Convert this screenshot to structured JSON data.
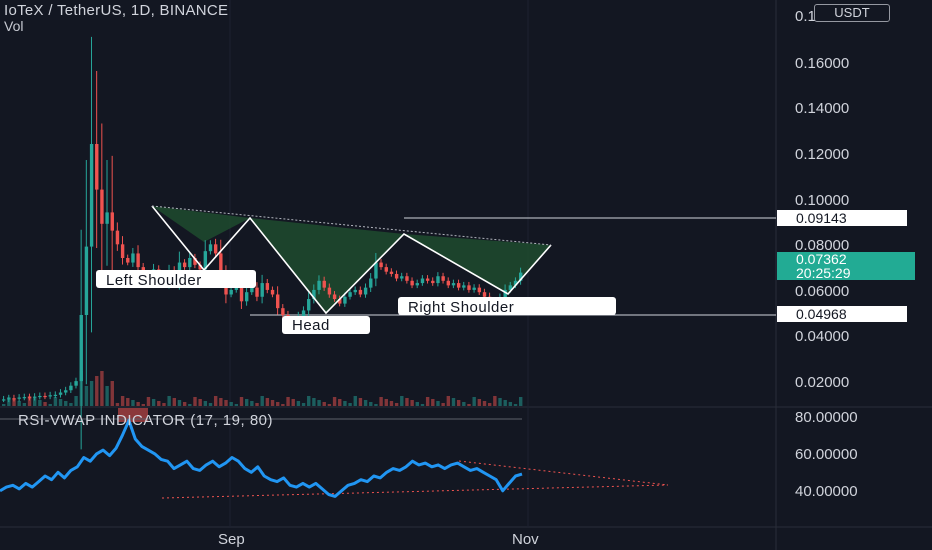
{
  "header": {
    "title": "IoTeX / TetherUS, 1D, BINANCE",
    "volume_label": "Vol",
    "currency_button": "USDT"
  },
  "colors": {
    "background": "#131722",
    "up": "#26a69a",
    "down": "#ef5350",
    "pattern_fill": "#1e4b2e",
    "rsi_line": "#2196f3",
    "last_price_tag": "#22ab94"
  },
  "price_axis": {
    "ticks": [
      "0.18000",
      "0.16000",
      "0.14000",
      "0.12000",
      "0.10000",
      "0.08000",
      "0.06000",
      "0.04000",
      "0.02000"
    ]
  },
  "rsi_axis": {
    "ticks": [
      "80.00000",
      "60.00000",
      "40.00000"
    ]
  },
  "time_axis": {
    "labels": [
      "Sep",
      "Nov"
    ]
  },
  "price_tags": {
    "resistance": "0.09143",
    "last_price": "0.07362",
    "countdown": "20:25:29",
    "support": "0.04968"
  },
  "annotations": {
    "left_shoulder": "Left Shoulder",
    "head": "Head",
    "right_shoulder": "Right Shoulder"
  },
  "indicator": {
    "title": "RSI-VWAP INDICATOR (17, 19, 80)"
  },
  "chart_data": {
    "type": "candlestick",
    "symbol": "IoTeX / TetherUS",
    "interval": "1D",
    "exchange": "BINANCE",
    "price_ylim": [
      0.0,
      0.19
    ],
    "rsi_ylim": [
      30,
      90
    ],
    "levels": {
      "resistance": 0.09143,
      "support": 0.04968,
      "last": 0.07362
    },
    "close_series": [
      0.018,
      0.0185,
      0.0183,
      0.0188,
      0.019,
      0.0187,
      0.0192,
      0.0195,
      0.0193,
      0.0198,
      0.02,
      0.021,
      0.022,
      0.024,
      0.026,
      0.055,
      0.085,
      0.13,
      0.11,
      0.095,
      0.1,
      0.092,
      0.086,
      0.08,
      0.078,
      0.082,
      0.076,
      0.073,
      0.071,
      0.075,
      0.072,
      0.069,
      0.074,
      0.07,
      0.078,
      0.076,
      0.08,
      0.077,
      0.075,
      0.083,
      0.086,
      0.082,
      0.072,
      0.064,
      0.066,
      0.068,
      0.061,
      0.065,
      0.067,
      0.063,
      0.069,
      0.066,
      0.064,
      0.058,
      0.055,
      0.052,
      0.05,
      0.054,
      0.057,
      0.062,
      0.066,
      0.07,
      0.067,
      0.064,
      0.062,
      0.06,
      0.063,
      0.065,
      0.066,
      0.064,
      0.067,
      0.071,
      0.078,
      0.076,
      0.074,
      0.073,
      0.071,
      0.072,
      0.07,
      0.068,
      0.069,
      0.071,
      0.07,
      0.069,
      0.072,
      0.07,
      0.068,
      0.069,
      0.067,
      0.068,
      0.066,
      0.067,
      0.065,
      0.063,
      0.06,
      0.058,
      0.062,
      0.066,
      0.068,
      0.07,
      0.0736
    ],
    "rsi_series": [
      42,
      44,
      45,
      43,
      46,
      44,
      47,
      50,
      48,
      52,
      49,
      53,
      55,
      60,
      58,
      62,
      64,
      61,
      65,
      72,
      80,
      70,
      66,
      64,
      62,
      59,
      58,
      54,
      56,
      58,
      54,
      53,
      56,
      58,
      55,
      57,
      60,
      58,
      54,
      52,
      55,
      50,
      48,
      47,
      49,
      45,
      44,
      46,
      44,
      46,
      43,
      40,
      39,
      42,
      45,
      46,
      48,
      47,
      50,
      49,
      52,
      54,
      53,
      55,
      58,
      56,
      57,
      55,
      56,
      54,
      56,
      57,
      55,
      53,
      54,
      52,
      50,
      48,
      42,
      46,
      50,
      51
    ],
    "rsi_trendlines": [
      {
        "from": [
          0,
          55.7
        ],
        "to": [
          1,
          46.6
        ]
      },
      {
        "from": [
          0,
          36.3
        ],
        "to": [
          1,
          46.6
        ]
      }
    ]
  }
}
